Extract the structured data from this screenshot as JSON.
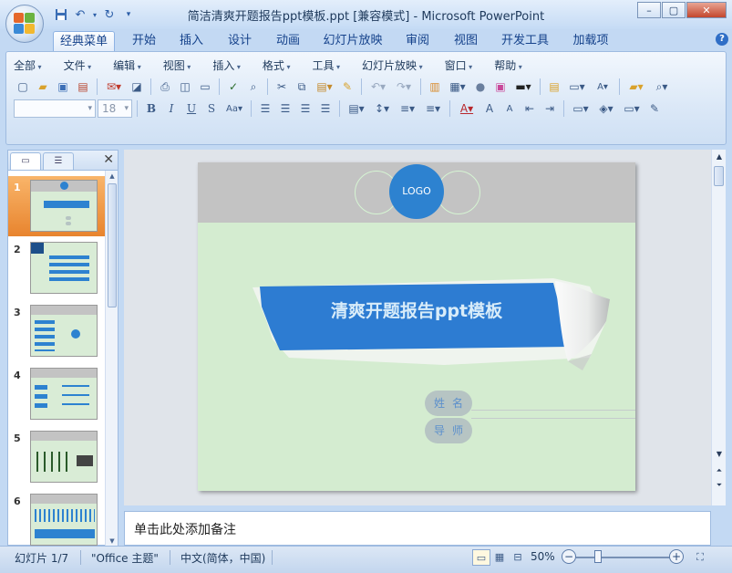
{
  "window": {
    "title": "简洁清爽开题报告ppt模板.ppt [兼容模式] - Microsoft PowerPoint",
    "buttons": {
      "minimize": "–",
      "maximize": "▢",
      "close": "✕"
    }
  },
  "qat": {
    "icons": [
      "save-icon",
      "undo-icon",
      "redo-icon",
      "customize-icon"
    ]
  },
  "ribbon": {
    "tabs": [
      "经典菜单",
      "开始",
      "插入",
      "设计",
      "动画",
      "幻灯片放映",
      "审阅",
      "视图",
      "开发工具",
      "加载项"
    ],
    "active_tab": 0,
    "help_label": "?"
  },
  "menubar": {
    "items": [
      "全部",
      "文件",
      "编辑",
      "视图",
      "插入",
      "格式",
      "工具",
      "幻灯片放映",
      "窗口",
      "帮助"
    ]
  },
  "font": {
    "name": "",
    "size": "18"
  },
  "slides_panel": {
    "close_label": "✕",
    "numbers": [
      "1",
      "2",
      "3",
      "4",
      "5",
      "6"
    ],
    "selected": 1
  },
  "slide": {
    "logo_text": "LOGO",
    "title": "清爽开题报告ppt模板",
    "name_label": "姓名",
    "advisor_label": "导师",
    "colors": {
      "background": "#d4ecd0",
      "header": "#c3c3c3",
      "accent": "#2d82d0"
    }
  },
  "notes": {
    "placeholder": "单击此处添加备注"
  },
  "status": {
    "slide_info": "幻灯片 1/7",
    "theme": "\"Office 主题\"",
    "language": "中文(简体，中国)",
    "zoom": "50%",
    "zoom_value": 50
  }
}
